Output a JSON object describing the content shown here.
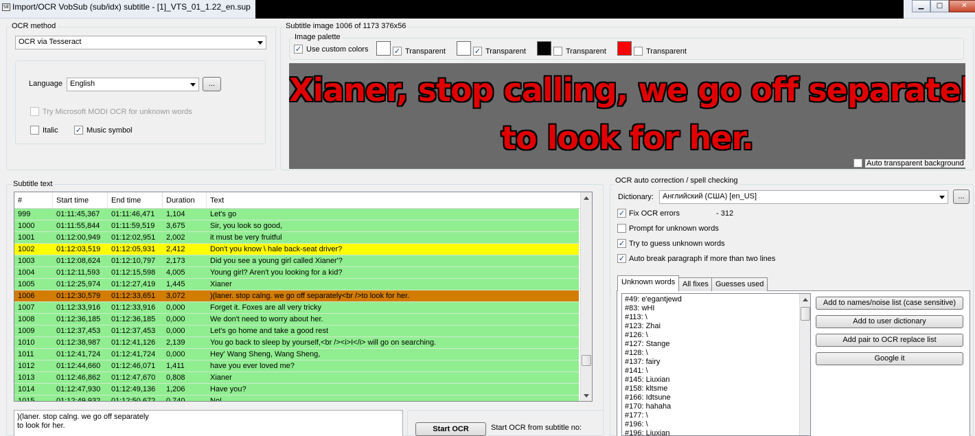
{
  "window": {
    "title": "Import/OCR VobSub (sub/idx) subtitle - [1]_VTS_01_1.22_en.sup",
    "app_icon": "SE",
    "buttons": {
      "minimize": "▁",
      "maximize": "□",
      "close": "✕"
    }
  },
  "ocr_method": {
    "group_label": "OCR method",
    "selected": "OCR via Tesseract",
    "language_label": "Language",
    "language_value": "English",
    "browse_label": "...",
    "modi_label": "Try Microsoft MODI OCR for unknown words",
    "modi_checked": false,
    "italic_label": "Italic",
    "italic_checked": false,
    "music_label": "Music symbol",
    "music_checked": true
  },
  "subtitle_image": {
    "group_label": "Subtitle image 1006 of 1173   376x56",
    "palette_label": "Image palette",
    "use_custom_label": "Use custom colors",
    "use_custom_checked": true,
    "palette": [
      {
        "color": "#ffffff",
        "checked": true,
        "label": "Transparent"
      },
      {
        "color": "#ffffff",
        "checked": true,
        "label": "Transparent"
      },
      {
        "color": "#000000",
        "checked": false,
        "label": "Transparent"
      },
      {
        "color": "#ff0000",
        "checked": false,
        "label": "Transparent"
      }
    ],
    "image_line1": "Xianer, stop calling, we go off separately",
    "image_line2": "to look for her.",
    "auto_transparent_label": "Auto transparent background",
    "auto_transparent_checked": false
  },
  "subtitle_text": {
    "group_label": "Subtitle text",
    "columns": [
      "#",
      "Start time",
      "End time",
      "Duration",
      "Text"
    ],
    "rows": [
      {
        "num": "999",
        "start": "01:11:45,367",
        "end": "01:11:46,471",
        "dur": "1,104",
        "text": "Let's go",
        "status": "ok"
      },
      {
        "num": "1000",
        "start": "01:11:55,844",
        "end": "01:11:59,519",
        "dur": "3,675",
        "text": "Sir, you look so good,",
        "status": "ok"
      },
      {
        "num": "1001",
        "start": "01:12:00,949",
        "end": "01:12:02,951",
        "dur": "2,002",
        "text": "it must be very fruitful",
        "status": "ok"
      },
      {
        "num": "1002",
        "start": "01:12:03,519",
        "end": "01:12:05,931",
        "dur": "2,412",
        "text": "Don't you know \\ hale back-seat driver?",
        "status": "warning"
      },
      {
        "num": "1003",
        "start": "01:12:08,624",
        "end": "01:12:10,797",
        "dur": "2,173",
        "text": "Did you see a young girl called Xianer'?",
        "status": "ok"
      },
      {
        "num": "1004",
        "start": "01:12:11,593",
        "end": "01:12:15,598",
        "dur": "4,005",
        "text": "Young girl? Aren't you looking for a kid?",
        "status": "ok"
      },
      {
        "num": "1005",
        "start": "01:12:25,974",
        "end": "01:12:27,419",
        "dur": "1,445",
        "text": "Xianer",
        "status": "ok"
      },
      {
        "num": "1006",
        "start": "01:12:30,579",
        "end": "01:12:33,651",
        "dur": "3,072",
        "text": ")(laner. stop calng. we go off separately<br />to look for her.",
        "status": "selected"
      },
      {
        "num": "1007",
        "start": "01:12:33,916",
        "end": "01:12:33,916",
        "dur": "0,000",
        "text": "Forget it. Foxes are all very tricky",
        "status": "ok"
      },
      {
        "num": "1008",
        "start": "01:12:36,185",
        "end": "01:12:36,185",
        "dur": "0,000",
        "text": "We don't need to worry about her.",
        "status": "ok"
      },
      {
        "num": "1009",
        "start": "01:12:37,453",
        "end": "01:12:37,453",
        "dur": "0,000",
        "text": "Let's go home and take a good rest",
        "status": "ok"
      },
      {
        "num": "1010",
        "start": "01:12:38,987",
        "end": "01:12:41,126",
        "dur": "2,139",
        "text": "You go back to sleep by yourself,<br /><i>I</i> will go on searching.",
        "status": "ok"
      },
      {
        "num": "1011",
        "start": "01:12:41,724",
        "end": "01:12:41,724",
        "dur": "0,000",
        "text": "Hey' Wang Sheng, Wang Sheng,",
        "status": "ok"
      },
      {
        "num": "1012",
        "start": "01:12:44,660",
        "end": "01:12:46,071",
        "dur": "1,411",
        "text": "have you ever loved me?",
        "status": "ok"
      },
      {
        "num": "1013",
        "start": "01:12:46,862",
        "end": "01:12:47,670",
        "dur": "0,808",
        "text": "Xianer",
        "status": "ok"
      },
      {
        "num": "1014",
        "start": "01:12:47,930",
        "end": "01:12:49,136",
        "dur": "1,206",
        "text": "Have you?",
        "status": "ok"
      },
      {
        "num": "1015",
        "start": "01:12:49,932",
        "end": "01:12:50,672",
        "dur": "0,740",
        "text": "No!",
        "status": "ok"
      }
    ],
    "row_colors": {
      "ok": "#90ee90",
      "warning": "#ffff00",
      "selected": "#d27c00"
    },
    "edit_text_line1": ")(laner. stop calng. we go off separately",
    "edit_text_line2": "to look for her."
  },
  "start_ocr": {
    "button_label": "Start OCR",
    "from_label": "Start OCR from subtitle no:"
  },
  "correction": {
    "group_label": "OCR auto correction / spell checking",
    "dictionary_label": "Dictionary:",
    "dictionary_value": "Английский (США) [en_US]",
    "browse_label": "...",
    "fix_errors_label": "Fix OCR errors",
    "fix_errors_checked": true,
    "fix_errors_count": "- 312",
    "prompt_label": "Prompt for unknown words",
    "prompt_checked": false,
    "guess_label": "Try to guess unknown words",
    "guess_checked": true,
    "autobreak_label": "Auto break paragraph if more than two lines",
    "autobreak_checked": true,
    "tabs": [
      "Unknown words",
      "All fixes",
      "Guesses used"
    ],
    "unknown_words": [
      "#49: e'egantjewd",
      "#83: wHI",
      "#113: \\",
      "#123: Zhai",
      "#126: \\",
      "#127: Stange",
      "#128: \\",
      "#137: fairy",
      "#141: \\",
      "#145: Liuxian",
      "#158: kltsme",
      "#166: Idtsune",
      "#170: hahaha",
      "#177: \\",
      "#196: \\",
      "#196: Liuxian"
    ],
    "buttons": [
      "Add to names/noise list (case sensitive)",
      "Add to user dictionary",
      "Add pair to OCR replace list",
      "Google it"
    ]
  },
  "icons": {
    "check": "✓",
    "combo_arrow": "chevron-down-icon"
  }
}
